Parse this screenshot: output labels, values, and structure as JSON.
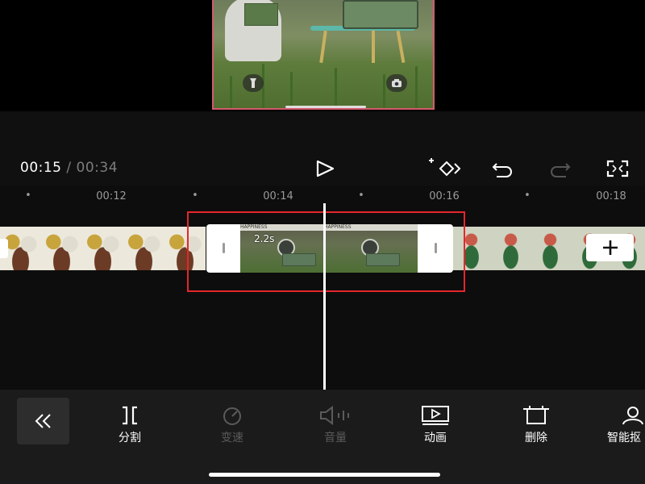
{
  "playback": {
    "current_time": "00:15",
    "separator": "/",
    "total_time": "00:34"
  },
  "timeline": {
    "ticks": [
      {
        "label": "00:12"
      },
      {
        "label": "00:14"
      },
      {
        "label": "00:16"
      },
      {
        "label": "00:18"
      }
    ],
    "tick_dot": "•",
    "selected_clip": {
      "duration": "2.2s",
      "banner_text": "HAPPINESS"
    }
  },
  "toolbar": {
    "items": [
      {
        "label": "分割",
        "icon": "split-icon",
        "enabled": true
      },
      {
        "label": "变速",
        "icon": "speed-icon",
        "enabled": false
      },
      {
        "label": "音量",
        "icon": "volume-icon",
        "enabled": false
      },
      {
        "label": "动画",
        "icon": "animation-icon",
        "enabled": true
      },
      {
        "label": "删除",
        "icon": "delete-icon",
        "enabled": true
      },
      {
        "label": "智能抠",
        "icon": "smart-cutout-icon",
        "enabled": true
      }
    ]
  },
  "colors": {
    "highlight": "#e5262c",
    "preview_border": "#d65a6e",
    "disabled": "#5b5b5b",
    "toolbar_bg": "#1b1b1b"
  }
}
